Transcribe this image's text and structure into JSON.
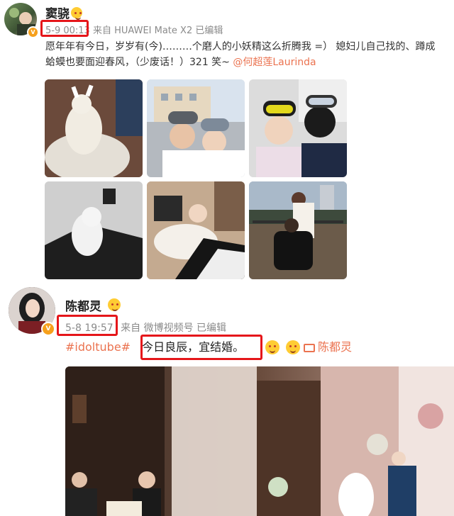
{
  "post1": {
    "username": "窦骁",
    "time": "5-9 00:13",
    "source": "来自 HUAWEI Mate X2 已编辑",
    "text_line1": "愿年年有今日，岁岁有(今)………个磨人的小妖精这么折腾我 =）  媳妇儿自己找的、蹲成",
    "text_line2_prefix": "蛤蟆也要面迎春风，（少废话！）321 笑~ ",
    "mention": "@何超莲Laurinda"
  },
  "post2": {
    "username": "陈都灵",
    "time": "5-8 19:57",
    "source": "来自 微博视频号 已编辑",
    "hashtag": "#idoltube#",
    "text": "今日良辰，宜结婚。",
    "video_link": "陈都灵"
  },
  "colors": {
    "highlight": "#e5161a",
    "link": "#eb7350",
    "vip": "#f6a01c"
  }
}
